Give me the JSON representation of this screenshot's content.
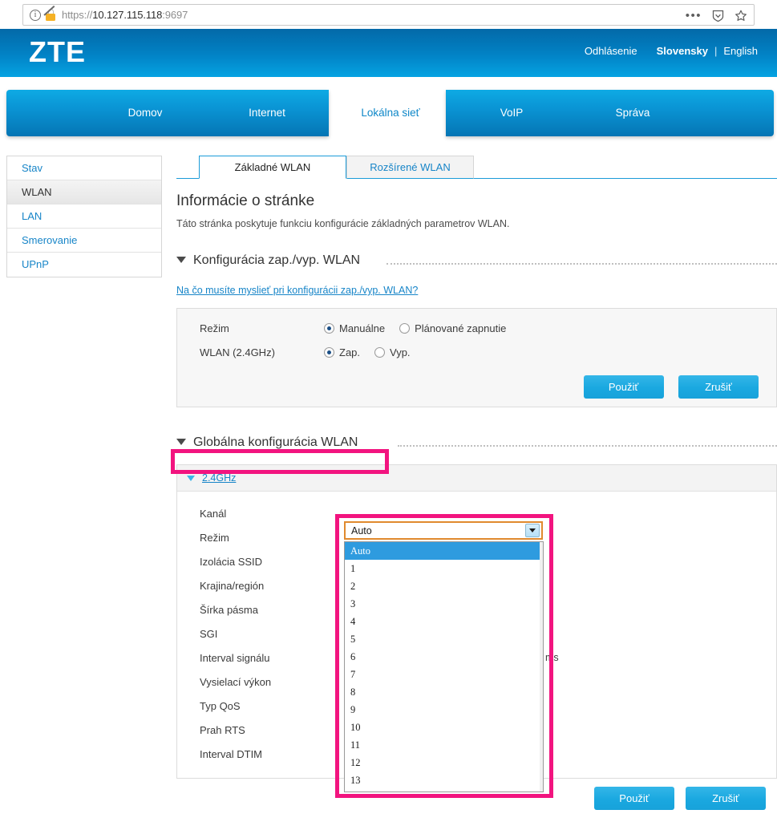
{
  "browser": {
    "url_prefix": "https://",
    "url_host": "10.127.115.118",
    "url_port": ":9697",
    "info_icon": "info-circle-icon",
    "lock_icon": "broken-lock-icon",
    "menu_icon": "ellipsis-icon",
    "shield_icon": "shield-icon",
    "bookmark_icon": "star-icon"
  },
  "header": {
    "logo": "ZTE",
    "logout": "Odhlásenie",
    "lang_active": "Slovensky",
    "lang_sep": "|",
    "lang_other": "English"
  },
  "nav": {
    "items": [
      {
        "label": "Domov",
        "active": false
      },
      {
        "label": "Internet",
        "active": false
      },
      {
        "label": "Lokálna sieť",
        "active": true
      },
      {
        "label": "VoIP",
        "active": false
      },
      {
        "label": "Správa",
        "active": false
      }
    ]
  },
  "sidebar": {
    "items": [
      {
        "label": "Stav",
        "active": false
      },
      {
        "label": "WLAN",
        "active": true
      },
      {
        "label": "LAN",
        "active": false
      },
      {
        "label": "Smerovanie",
        "active": false
      },
      {
        "label": "UPnP",
        "active": false
      }
    ]
  },
  "content_tabs": [
    {
      "label": "Základné WLAN",
      "active": true
    },
    {
      "label": "Rozšírené WLAN",
      "active": false
    }
  ],
  "page": {
    "title": "Informácie o stránke",
    "description": "Táto stránka poskytuje funkciu konfigurácie základných parametrov WLAN."
  },
  "section_onoff": {
    "title": "Konfigurácia zap./vyp. WLAN",
    "hint_link": "Na čo musíte myslieť pri konfigurácii zap./vyp. WLAN?",
    "rows": [
      {
        "label": "Režim",
        "options": [
          {
            "label": "Manuálne",
            "checked": true
          },
          {
            "label": "Plánované zapnutie",
            "checked": false
          }
        ]
      },
      {
        "label": "WLAN (2.4GHz)",
        "options": [
          {
            "label": "Zap.",
            "checked": true
          },
          {
            "label": "Vyp.",
            "checked": false
          }
        ]
      }
    ],
    "apply_label": "Použiť",
    "cancel_label": "Zrušiť"
  },
  "section_global": {
    "title": "Globálna konfigurácia WLAN",
    "band_title": "2.4GHz",
    "labels": [
      "Kanál",
      "Režim",
      "Izolácia SSID",
      "Krajina/región",
      "Šírka pásma",
      "SGI",
      "Interval signálu",
      "Vysielací výkon",
      "Typ QoS",
      "Prah RTS",
      "Interval DTIM"
    ],
    "beacon_unit": "ms",
    "apply_label": "Použiť",
    "cancel_label": "Zrušiť"
  },
  "channel_select": {
    "name": "Kanál",
    "value": "Auto",
    "expanded": true,
    "options": [
      "Auto",
      "1",
      "2",
      "3",
      "4",
      "5",
      "6",
      "7",
      "8",
      "9",
      "10",
      "11",
      "12",
      "13"
    ],
    "selected_index": 0
  },
  "annotations": {
    "highlight_color": "#f2147f",
    "focus_color": "#e08a2e",
    "boxes": [
      "Globálna konfigurácia WLAN",
      "Kanál dropdown"
    ]
  }
}
